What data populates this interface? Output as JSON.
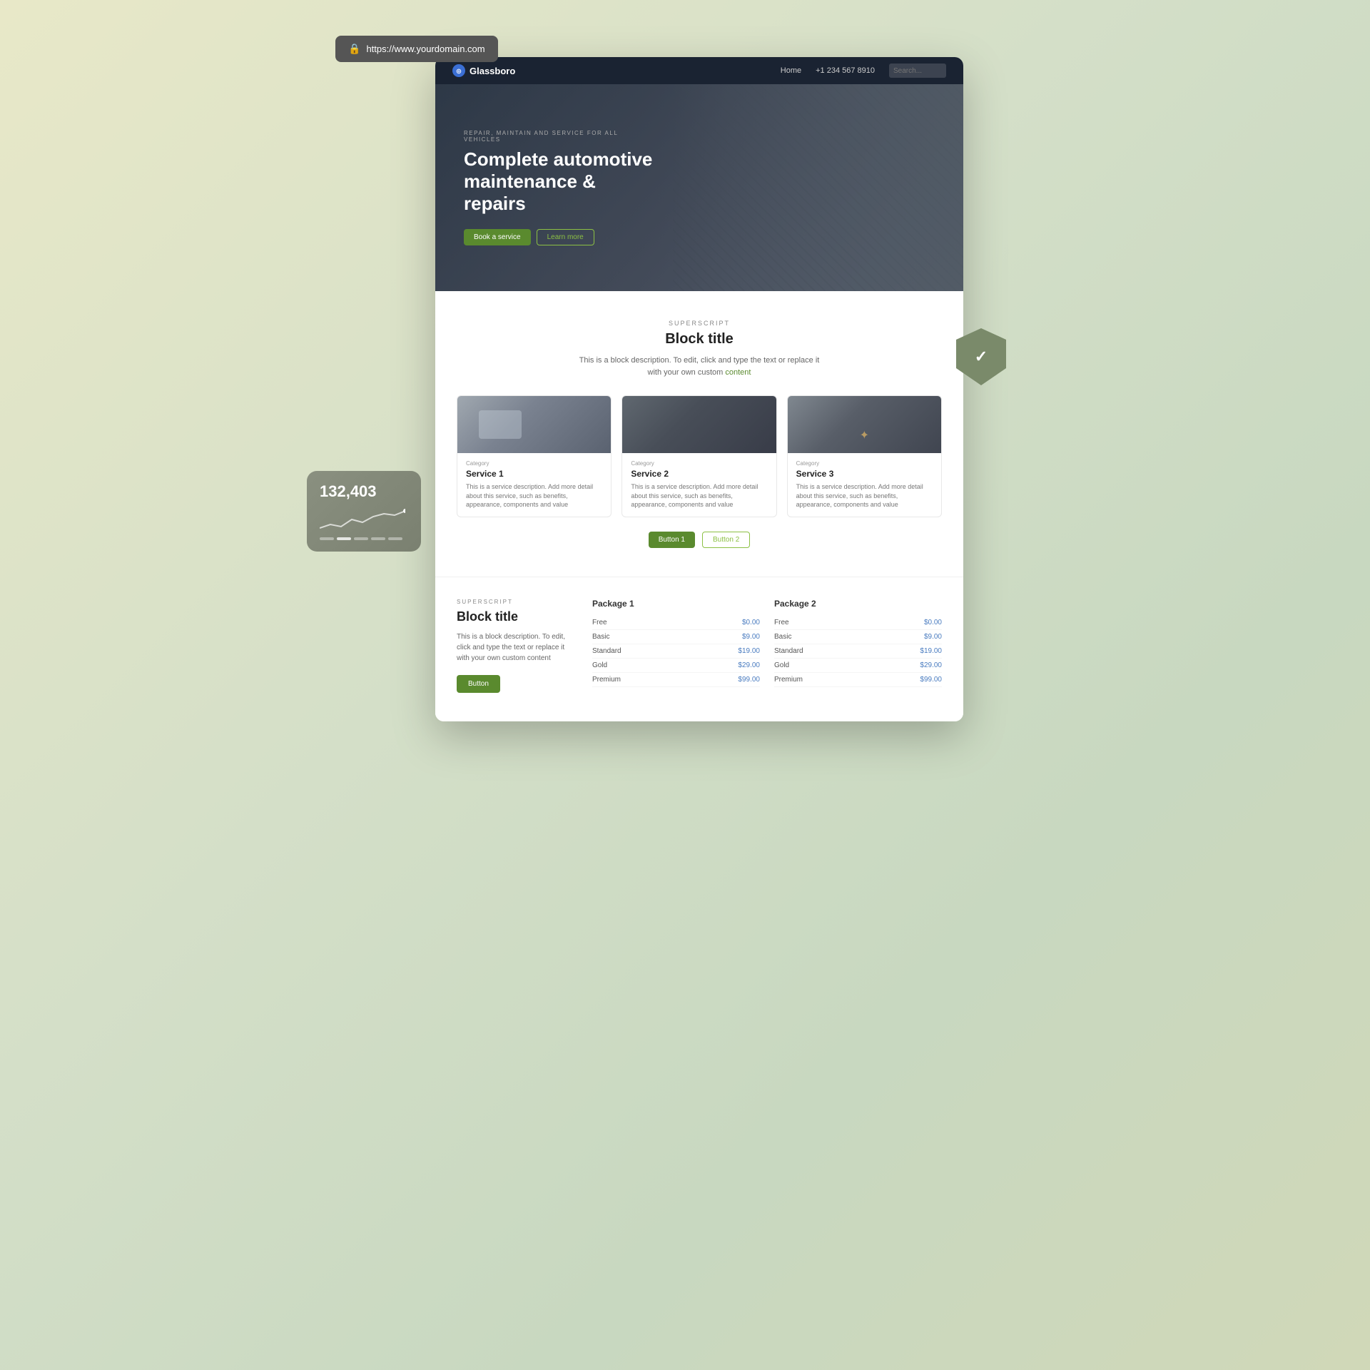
{
  "browser": {
    "url": "https://www.yourdomain.com",
    "lock_icon": "🔒"
  },
  "nav": {
    "logo": "Glassboro",
    "home_link": "Home",
    "phone": "+1 234 567 8910",
    "search_placeholder": "Search..."
  },
  "hero": {
    "superscript": "REPAIR, MAINTAIN AND SERVICE FOR ALL VEHICLES",
    "title": "Complete automotive maintenance & repairs",
    "book_button": "Book a service",
    "learn_button": "Learn more"
  },
  "services_section": {
    "superscript": "SUPERSCRIPT",
    "title": "Block title",
    "description": "This is a block description. To edit, click and type the text or replace it with your own custom",
    "description_link": "content",
    "cards": [
      {
        "category": "Category",
        "title": "Service 1",
        "description": "This is a service description. Add more detail about this service, such as benefits, appearance, components and value"
      },
      {
        "category": "Category",
        "title": "Service 2",
        "description": "This is a service description. Add more detail about this service, such as benefits, appearance, components and value"
      },
      {
        "category": "Category",
        "title": "Service 3",
        "description": "This is a service description. Add more detail about this service, such as benefits, appearance, components and value"
      }
    ],
    "button1": "Button 1",
    "button2": "Button 2"
  },
  "pricing_section": {
    "superscript": "SUPERSCRIPT",
    "title": "Block title",
    "description": "This is a block description. To edit, click and type the text or replace it with your own custom content",
    "button": "Button",
    "package1": {
      "title": "Package 1",
      "rows": [
        {
          "label": "Free",
          "value": "$0.00"
        },
        {
          "label": "Basic",
          "value": "$9.00"
        },
        {
          "label": "Standard",
          "value": "$19.00"
        },
        {
          "label": "Gold",
          "value": "$29.00"
        },
        {
          "label": "Premium",
          "value": "$99.00"
        }
      ]
    },
    "package2": {
      "title": "Package 2",
      "rows": [
        {
          "label": "Free",
          "value": "$0.00"
        },
        {
          "label": "Basic",
          "value": "$9.00"
        },
        {
          "label": "Standard",
          "value": "$19.00"
        },
        {
          "label": "Gold",
          "value": "$29.00"
        },
        {
          "label": "Premium",
          "value": "$99.00"
        }
      ]
    }
  },
  "stats_card": {
    "number": "132,403"
  },
  "colors": {
    "accent_green": "#5a8a2e",
    "accent_blue": "#4a7cc0",
    "nav_bg": "#1a2332"
  }
}
